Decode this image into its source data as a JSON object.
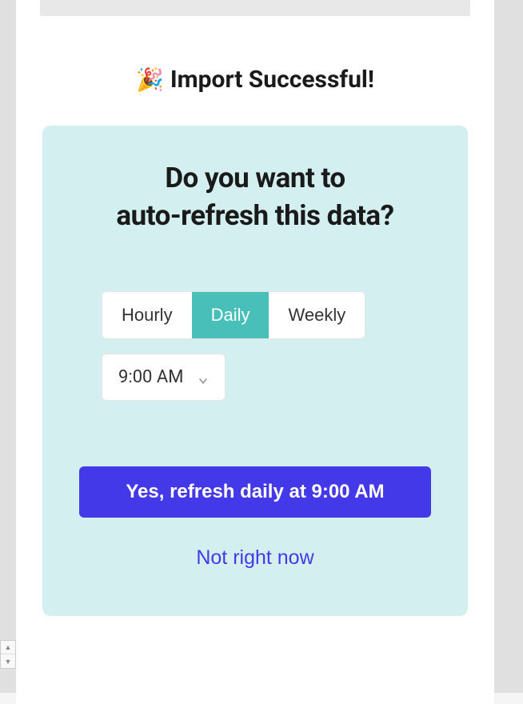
{
  "header": {
    "emoji": "🎉",
    "title": "Import Successful!"
  },
  "panel": {
    "question_line1": "Do you want to",
    "question_line2": "auto-refresh this data?",
    "frequency": {
      "options": [
        "Hourly",
        "Daily",
        "Weekly"
      ],
      "selected": "Daily"
    },
    "time": {
      "selected": "9:00 AM"
    },
    "primary_button": "Yes, refresh daily at 9:00 AM",
    "secondary_link": "Not right now"
  }
}
